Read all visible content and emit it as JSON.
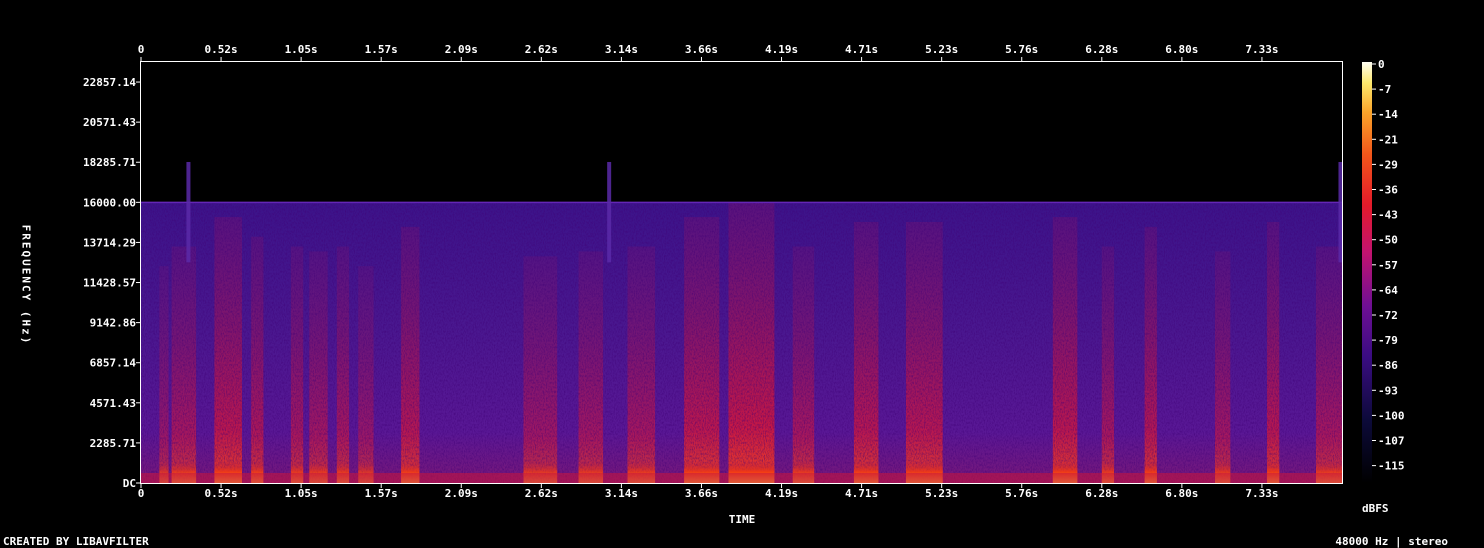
{
  "chart_data": {
    "type": "heatmap",
    "title": "",
    "xlabel": "TIME",
    "ylabel": "FREQUENCY (Hz)",
    "x_ticks": [
      "0",
      "0.52s",
      "1.05s",
      "1.57s",
      "2.09s",
      "2.62s",
      "3.14s",
      "3.66s",
      "4.19s",
      "4.71s",
      "5.23s",
      "5.76s",
      "6.28s",
      "6.80s",
      "7.33s"
    ],
    "y_ticks": [
      "DC",
      "2285.71",
      "4571.43",
      "6857.14",
      "9142.86",
      "11428.57",
      "13714.29",
      "16000.00",
      "18285.71",
      "20571.43",
      "22857.14"
    ],
    "x_range_s": [
      0,
      7.85
    ],
    "y_range_hz": [
      0,
      24000
    ],
    "content_cutoff_hz": 16000,
    "colorbar": {
      "label": "dBFS",
      "ticks": [
        "0",
        "-7",
        "-14",
        "-21",
        "-29",
        "-36",
        "-43",
        "-50",
        "-57",
        "-64",
        "-72",
        "-79",
        "-86",
        "-93",
        "-100",
        "-107",
        "-115"
      ],
      "range": [
        -120,
        0
      ]
    },
    "energy_bands": [
      {
        "t": [
          0.12,
          0.18
        ],
        "level": 0.35
      },
      {
        "t": [
          0.2,
          0.36
        ],
        "level": 0.55
      },
      {
        "t": [
          0.48,
          0.66
        ],
        "level": 0.85
      },
      {
        "t": [
          0.72,
          0.8
        ],
        "level": 0.65
      },
      {
        "t": [
          0.98,
          1.06
        ],
        "level": 0.55
      },
      {
        "t": [
          1.1,
          1.22
        ],
        "level": 0.5
      },
      {
        "t": [
          1.28,
          1.36
        ],
        "level": 0.55
      },
      {
        "t": [
          1.42,
          1.52
        ],
        "level": 0.35
      },
      {
        "t": [
          1.7,
          1.82
        ],
        "level": 0.75
      },
      {
        "t": [
          2.5,
          2.72
        ],
        "level": 0.45
      },
      {
        "t": [
          2.86,
          3.02
        ],
        "level": 0.5
      },
      {
        "t": [
          3.18,
          3.36
        ],
        "level": 0.55
      },
      {
        "t": [
          3.55,
          3.78
        ],
        "level": 0.85
      },
      {
        "t": [
          3.84,
          4.14
        ],
        "level": 1.0
      },
      {
        "t": [
          4.26,
          4.4
        ],
        "level": 0.55
      },
      {
        "t": [
          4.66,
          4.82
        ],
        "level": 0.8
      },
      {
        "t": [
          5.0,
          5.24
        ],
        "level": 0.8
      },
      {
        "t": [
          5.96,
          6.12
        ],
        "level": 0.85
      },
      {
        "t": [
          6.28,
          6.36
        ],
        "level": 0.55
      },
      {
        "t": [
          6.56,
          6.64
        ],
        "level": 0.75
      },
      {
        "t": [
          7.02,
          7.12
        ],
        "level": 0.5
      },
      {
        "t": [
          7.36,
          7.44
        ],
        "level": 0.8
      },
      {
        "t": [
          7.68,
          7.85
        ],
        "level": 0.55
      }
    ],
    "transient_lines_s": [
      0.31,
      3.06,
      7.84
    ]
  },
  "footer": {
    "left": "CREATED BY LIBAVFILTER",
    "right": "48000 Hz | stereo"
  }
}
